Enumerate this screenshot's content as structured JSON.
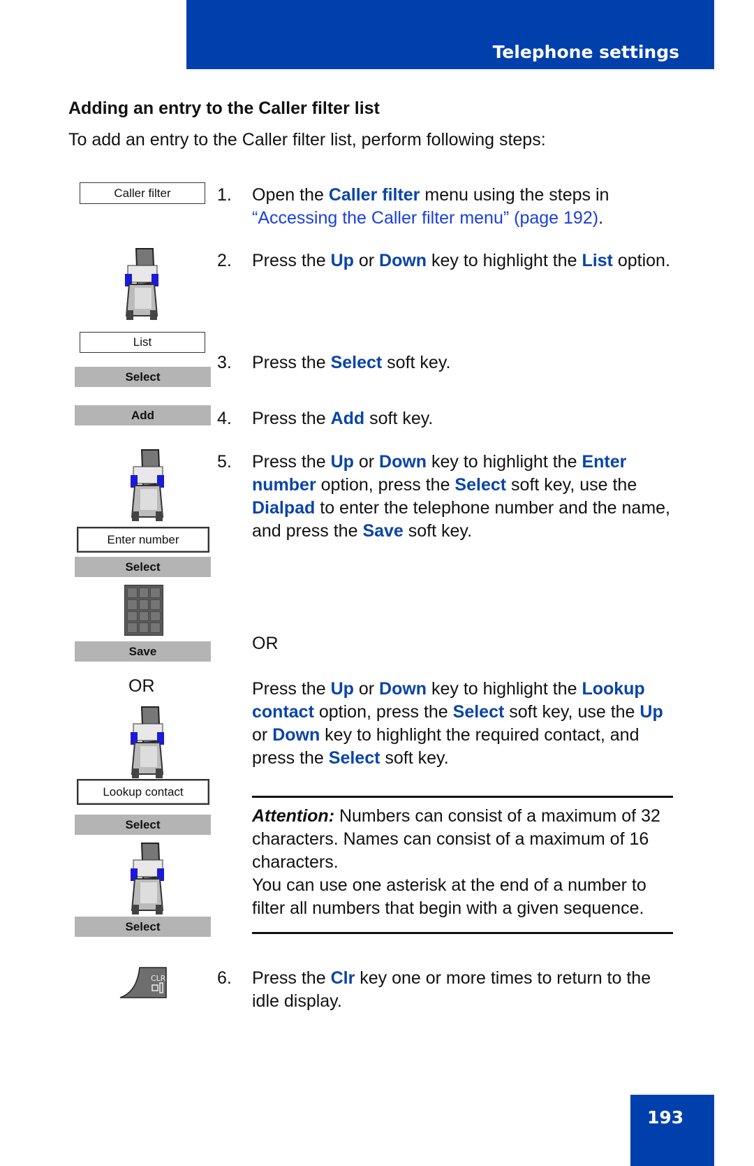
{
  "header": {
    "title": "Telephone settings",
    "bar_color": "#0040ac"
  },
  "section_heading": "Adding an entry to the Caller filter list",
  "intro": "To add an entry to the Caller filter list, perform following steps:",
  "left_column": {
    "menu_caller_filter": "Caller filter",
    "menu_list": "List",
    "softkey_select_1": "Select",
    "softkey_add": "Add",
    "menu_enter_number": "Enter number",
    "softkey_select_2": "Select",
    "softkey_save": "Save",
    "or_label": "OR",
    "menu_lookup_contact": "Lookup contact",
    "softkey_select_3": "Select",
    "softkey_select_4": "Select",
    "clr_key_label": "CLR"
  },
  "steps": [
    {
      "num": "1.",
      "parts": [
        "Open the ",
        "Caller filter",
        " menu using the steps in ",
        "“Accessing the Caller filter menu” (page 192)",
        "."
      ]
    },
    {
      "num": "2.",
      "parts": [
        "Press the ",
        "Up",
        " or ",
        "Down",
        " key to highlight the ",
        "List",
        " option."
      ]
    },
    {
      "num": "3.",
      "parts": [
        "Press the ",
        "Select",
        " soft key."
      ]
    },
    {
      "num": "4.",
      "parts": [
        "Press the ",
        "Add",
        " soft key."
      ]
    },
    {
      "num": "5.",
      "parts": [
        "Press the ",
        "Up",
        " or ",
        "Down",
        " key to highlight the ",
        "Enter number",
        " option, press the ",
        "Select",
        " soft key, use the ",
        "Dialpad",
        " to enter the telephone number and the name, and press the ",
        "Save",
        " soft key."
      ]
    },
    {
      "num": "6.",
      "parts": [
        "Press the ",
        "Clr",
        " key one or more times to return to the idle display."
      ]
    }
  ],
  "or_label": "OR",
  "alt_step": {
    "parts": [
      "Press the ",
      "Up",
      " or ",
      "Down",
      " key to highlight the ",
      "Lookup contact",
      " option, press the ",
      "Select",
      " soft key, use the ",
      "Up",
      " or ",
      "Down",
      " key to highlight the required contact, and press the ",
      "Select",
      " soft key."
    ]
  },
  "attention": {
    "label": "Attention:",
    "line1": " Numbers can consist of a maximum of 32 characters. Names can consist of a maximum of 16 characters.",
    "line2": "You can use one asterisk at the end of a number to filter all numbers that begin with a given sequence."
  },
  "page_number": "193",
  "colors": {
    "keyword": "#0a44a8",
    "link": "#1a3fe0",
    "softkey_bg": "#b4b4b4"
  }
}
